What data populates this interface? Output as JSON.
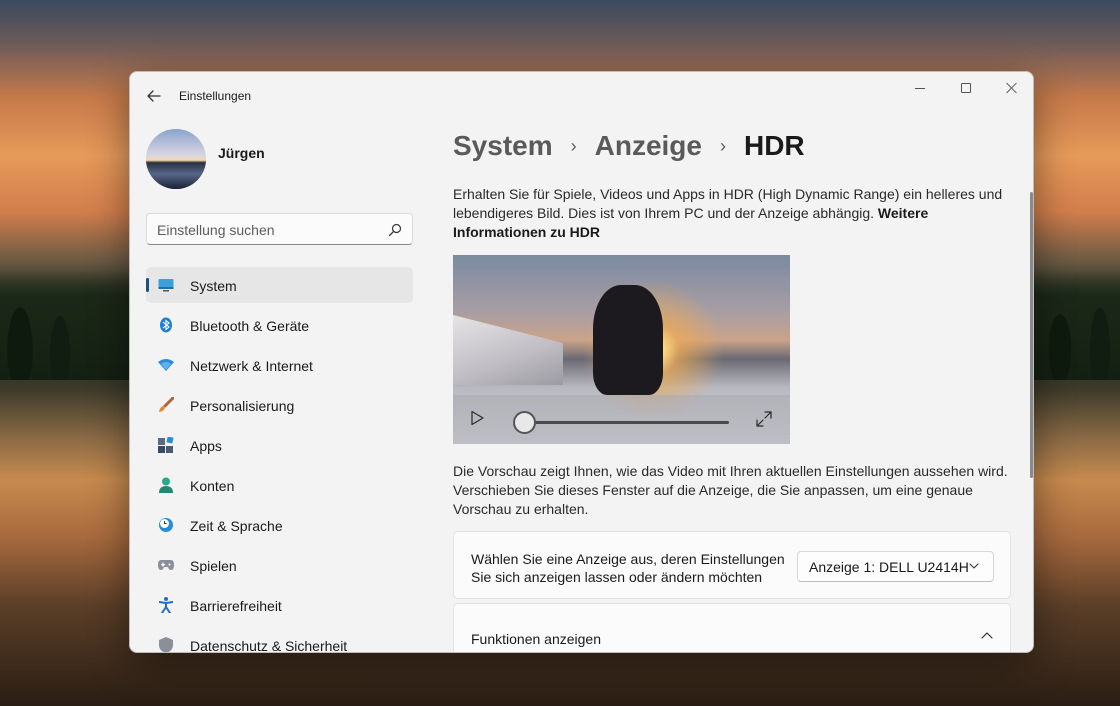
{
  "window": {
    "title": "Einstellungen",
    "back_icon": "back-arrow-icon",
    "controls": [
      "minimize-icon",
      "maximize-icon",
      "close-icon"
    ]
  },
  "profile": {
    "name": "Jürgen",
    "avatar_icon": "profile-avatar"
  },
  "search": {
    "placeholder": "Einstellung suchen",
    "icon": "search-icon"
  },
  "sidebar": {
    "items": [
      {
        "label": "System",
        "icon": "system-display-icon",
        "active": true
      },
      {
        "label": "Bluetooth & Geräte",
        "icon": "bluetooth-icon"
      },
      {
        "label": "Netzwerk & Internet",
        "icon": "wifi-icon"
      },
      {
        "label": "Personalisierung",
        "icon": "paintbrush-icon"
      },
      {
        "label": "Apps",
        "icon": "apps-icon"
      },
      {
        "label": "Konten",
        "icon": "user-icon"
      },
      {
        "label": "Zeit & Sprache",
        "icon": "clock-globe-icon"
      },
      {
        "label": "Spielen",
        "icon": "gamepad-icon"
      },
      {
        "label": "Barrierefreiheit",
        "icon": "accessibility-icon"
      },
      {
        "label": "Datenschutz & Sicherheit",
        "icon": "shield-icon"
      }
    ]
  },
  "breadcrumb": {
    "parts": [
      "System",
      "Anzeige"
    ],
    "current": "HDR",
    "separator": "›"
  },
  "intro": {
    "text": "Erhalten Sie für Spiele, Videos und Apps in HDR (High Dynamic Range) ein helleres und lebendigeres Bild. Dies ist von Ihrem PC und der Anzeige abhängig. ",
    "link": "Weitere Informationen zu HDR"
  },
  "video": {
    "play_icon": "play-icon",
    "fullscreen_icon": "fullscreen-icon",
    "progress": 0
  },
  "preview_text": "Die Vorschau zeigt Ihnen, wie das Video mit Ihren aktuellen Einstellungen aussehen wird. Verschieben Sie dieses Fenster auf die Anzeige, die Sie anpassen, um eine genaue Vorschau zu erhalten.",
  "display_select": {
    "label": "Wählen Sie eine Anzeige aus, deren Einstellungen Sie sich anzeigen lassen oder ändern möchten",
    "value": "Anzeige 1: DELL U2414H"
  },
  "features": {
    "label": "Funktionen anzeigen",
    "expanded": true
  },
  "colors": {
    "accent": "#1a4f8a",
    "window_bg": "#f3f3f3",
    "card_bg": "#fbfbfb"
  }
}
